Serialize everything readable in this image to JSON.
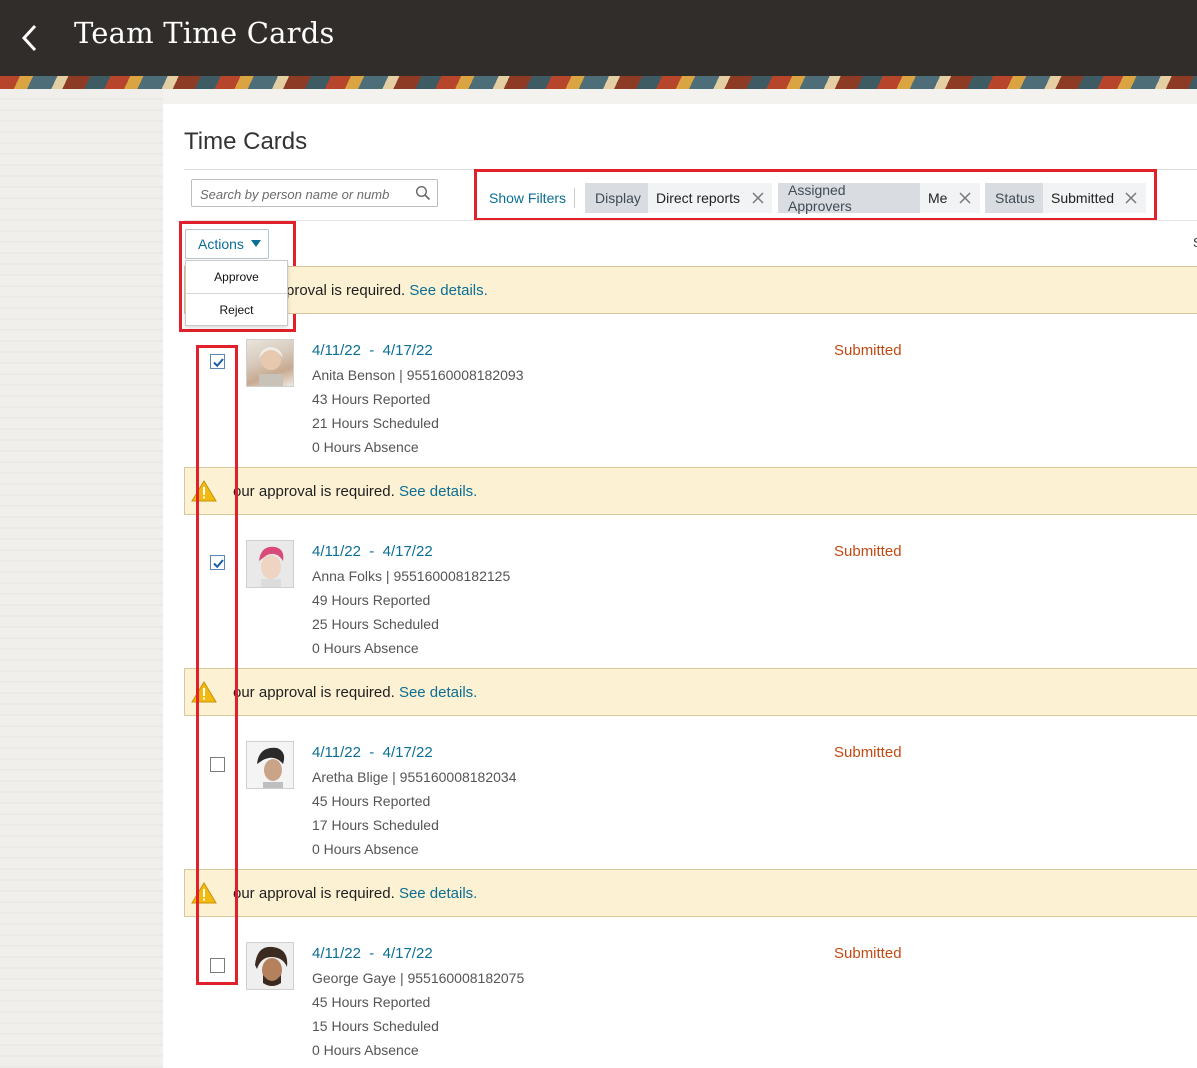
{
  "header": {
    "title": "Team Time Cards"
  },
  "section": {
    "title": "Time Cards"
  },
  "search": {
    "placeholder": "Search by person name or numb"
  },
  "filters": {
    "show_label": "Show Filters",
    "chips": [
      {
        "key": "Display",
        "value": "Direct reports"
      },
      {
        "key": "Assigned Approvers",
        "value": "Me"
      },
      {
        "key": "Status",
        "value": "Submitted"
      }
    ]
  },
  "actions": {
    "label": "Actions",
    "menu": [
      "Approve",
      "Reject"
    ]
  },
  "truncated_right_text": "S",
  "alert": {
    "first_text_visible": "proval is required.",
    "text_visible": "our approval is required.",
    "link": "See details."
  },
  "cards": [
    {
      "date_from": "4/11/22",
      "date_to": "4/17/22",
      "name_id": "Anita Benson | 955160008182093",
      "reported": "43 Hours Reported",
      "scheduled": "21 Hours Scheduled",
      "absence": "0 Hours Absence",
      "status": "Submitted",
      "checked": true
    },
    {
      "date_from": "4/11/22",
      "date_to": "4/17/22",
      "name_id": "Anna Folks | 955160008182125",
      "reported": "49 Hours Reported",
      "scheduled": "25 Hours Scheduled",
      "absence": "0 Hours Absence",
      "status": "Submitted",
      "checked": true
    },
    {
      "date_from": "4/11/22",
      "date_to": "4/17/22",
      "name_id": "Aretha Blige | 955160008182034",
      "reported": "45 Hours Reported",
      "scheduled": "17 Hours Scheduled",
      "absence": "0 Hours Absence",
      "status": "Submitted",
      "checked": false
    },
    {
      "date_from": "4/11/22",
      "date_to": "4/17/22",
      "name_id": "George Gaye | 955160008182075",
      "reported": "45 Hours Reported",
      "scheduled": "15 Hours Scheduled",
      "absence": "0 Hours Absence",
      "status": "Submitted",
      "checked": false
    }
  ],
  "colors": {
    "header_bg": "#312d2a",
    "link": "#0b6e94",
    "status": "#c24a11",
    "alert_bg": "#fcf1d3",
    "highlight": "#e0202b"
  }
}
